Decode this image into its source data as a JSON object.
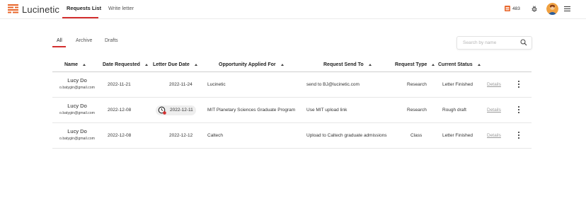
{
  "app": {
    "name": "Lucinetic"
  },
  "nav": {
    "tabs": [
      "Requests List",
      "Write letter"
    ]
  },
  "header": {
    "credits": "483"
  },
  "filters": {
    "tabs": [
      "All",
      "Archive",
      "Drafts"
    ]
  },
  "search": {
    "placeholder": "Search by name"
  },
  "table": {
    "columns": [
      "Name",
      "Date Requested",
      "Letter Due Date",
      "Opportunity Applied For",
      "Request Send To",
      "Request Type",
      "Current Status"
    ],
    "details_label": "Details",
    "rows": [
      {
        "name": "Lucy Do",
        "email": "o.batygin@gmail.com",
        "date_requested": "2022-11-21",
        "due_date": "2022-11-24",
        "opportunity": "Lucinetic",
        "send_to": "send to BJ@lucinetic.com",
        "type": "Research",
        "status": "Letter Finished",
        "overdue": false
      },
      {
        "name": "Lucy Do",
        "email": "o.batygin@gmail.com",
        "date_requested": "2022-12-08",
        "due_date": "2022-12-11",
        "opportunity": "MIT Planetary Sciences Graduate Program",
        "send_to": "Use MIT upload link",
        "type": "Research",
        "status": "Rough draft",
        "overdue": true
      },
      {
        "name": "Lucy Do",
        "email": "o.batygin@gmail.com",
        "date_requested": "2022-12-08",
        "due_date": "2022-12-12",
        "opportunity": "Caltech",
        "send_to": "Upload to Caltech graduate admissions",
        "type": "Class",
        "status": "Letter Finished",
        "overdue": false
      }
    ]
  },
  "colors": {
    "accent": "#d32f2f",
    "logo": "#e8662a"
  },
  "icons": [
    "logo-icon",
    "coin-icon",
    "bug-icon",
    "avatar",
    "hamburger-menu-icon",
    "search-icon",
    "sort-icon",
    "clock-alert-icon",
    "more-vertical-icon"
  ]
}
